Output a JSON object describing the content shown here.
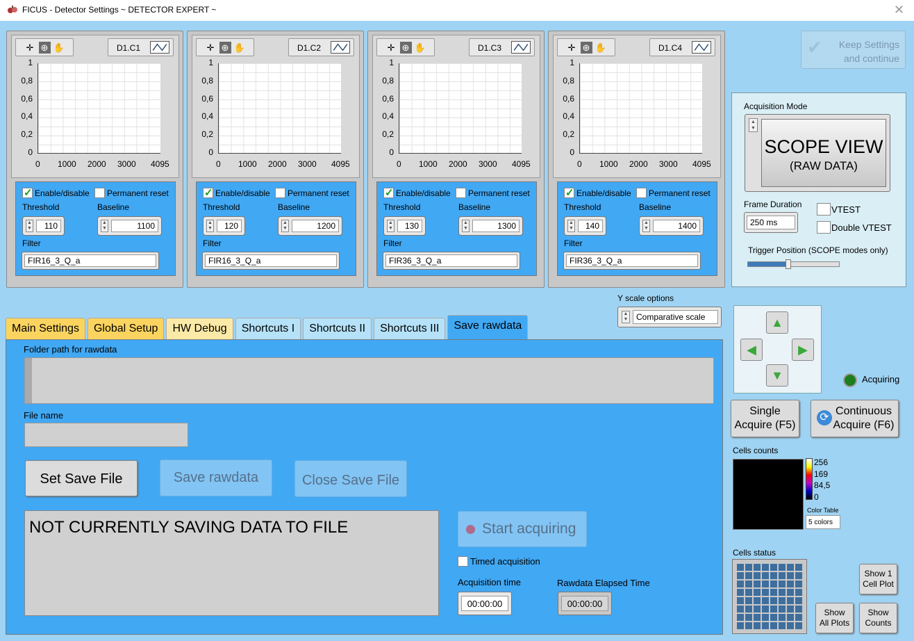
{
  "window": {
    "title": "FICUS - Detector Settings ~ DETECTOR EXPERT ~",
    "close_glyph": "✕"
  },
  "channels": [
    {
      "name": "D1.C1",
      "enable_label": "Enable/disable",
      "permanent_reset_label": "Permanent reset",
      "threshold_label": "Threshold",
      "threshold": "110",
      "baseline_label": "Baseline",
      "baseline": "1100",
      "filter_label": "Filter",
      "filter": "FIR16_3_Q_a"
    },
    {
      "name": "D1.C2",
      "enable_label": "Enable/disable",
      "permanent_reset_label": "Permanent reset",
      "threshold_label": "Threshold",
      "threshold": "120",
      "baseline_label": "Baseline",
      "baseline": "1200",
      "filter_label": "Filter",
      "filter": "FIR16_3_Q_a"
    },
    {
      "name": "D1.C3",
      "enable_label": "Enable/disable",
      "permanent_reset_label": "Permanent reset",
      "threshold_label": "Threshold",
      "threshold": "130",
      "baseline_label": "Baseline",
      "baseline": "1300",
      "filter_label": "Filter",
      "filter": "FIR36_3_Q_a"
    },
    {
      "name": "D1.C4",
      "enable_label": "Enable/disable",
      "permanent_reset_label": "Permanent reset",
      "threshold_label": "Threshold",
      "threshold": "140",
      "baseline_label": "Baseline",
      "baseline": "1400",
      "filter_label": "Filter",
      "filter": "FIR36_3_Q_a"
    }
  ],
  "plot_axes": {
    "y_ticks": [
      "1",
      "0,8",
      "0,6",
      "0,4",
      "0,2",
      "0"
    ],
    "x_ticks": [
      "0",
      "1000",
      "2000",
      "3000",
      "4095"
    ]
  },
  "keep_settings": {
    "line1": "Keep Settings",
    "line2": "and continue"
  },
  "acquisition": {
    "mode_label": "Acquisition Mode",
    "mode_main": "SCOPE VIEW",
    "mode_sub": "(RAW DATA)",
    "frame_duration_label": "Frame Duration",
    "frame_duration": "250 ms",
    "vtest_label": "VTEST",
    "double_vtest_label": "Double VTEST",
    "trigger_label": "Trigger Position (SCOPE modes only)",
    "trigger_position": 0.44
  },
  "y_scale": {
    "label": "Y scale options",
    "value": "Comparative scale"
  },
  "tabs": [
    "Main Settings",
    "Global Setup",
    "HW Debug",
    "Shortcuts I",
    "Shortcuts II",
    "Shortcuts III",
    "Save rawdata"
  ],
  "save_tab": {
    "folder_label": "Folder path for rawdata",
    "folder_value": "",
    "file_label": "File name",
    "file_value": "",
    "set_save_file": "Set Save File",
    "save_rawdata": "Save rawdata",
    "close_save_file": "Close Save File",
    "status_message": "NOT CURRENTLY SAVING DATA TO FILE",
    "start_acquiring": "Start acquiring",
    "timed_acquisition": "Timed acquisition",
    "acq_time_label": "Acquisition time",
    "acq_time": "00:00:00",
    "elapsed_label": "Rawdata Elapsed Time",
    "elapsed": "00:00:00"
  },
  "status": {
    "acquiring_label": "Acquiring"
  },
  "buttons": {
    "single_line1": "Single",
    "single_line2": "Acquire (F5)",
    "continuous_line1": "Continuous",
    "continuous_line2": "Acquire (F6)",
    "show1_line1": "Show 1",
    "show1_line2": "Cell Plot",
    "show_all_line1": "Show",
    "show_all_line2": "All Plots",
    "show_counts_line1": "Show",
    "show_counts_line2": "Counts"
  },
  "cells_counts": {
    "label": "Cells counts",
    "scale": [
      "256",
      "169",
      "84,5",
      "0"
    ],
    "color_table_label": "Color Table",
    "color_table_value": "5 colors"
  },
  "cells_status": {
    "label": "Cells status"
  },
  "colors": {
    "panel_blue": "#41a8f4",
    "background": "#9fd3f3",
    "led_green": "#1e7d1e"
  }
}
